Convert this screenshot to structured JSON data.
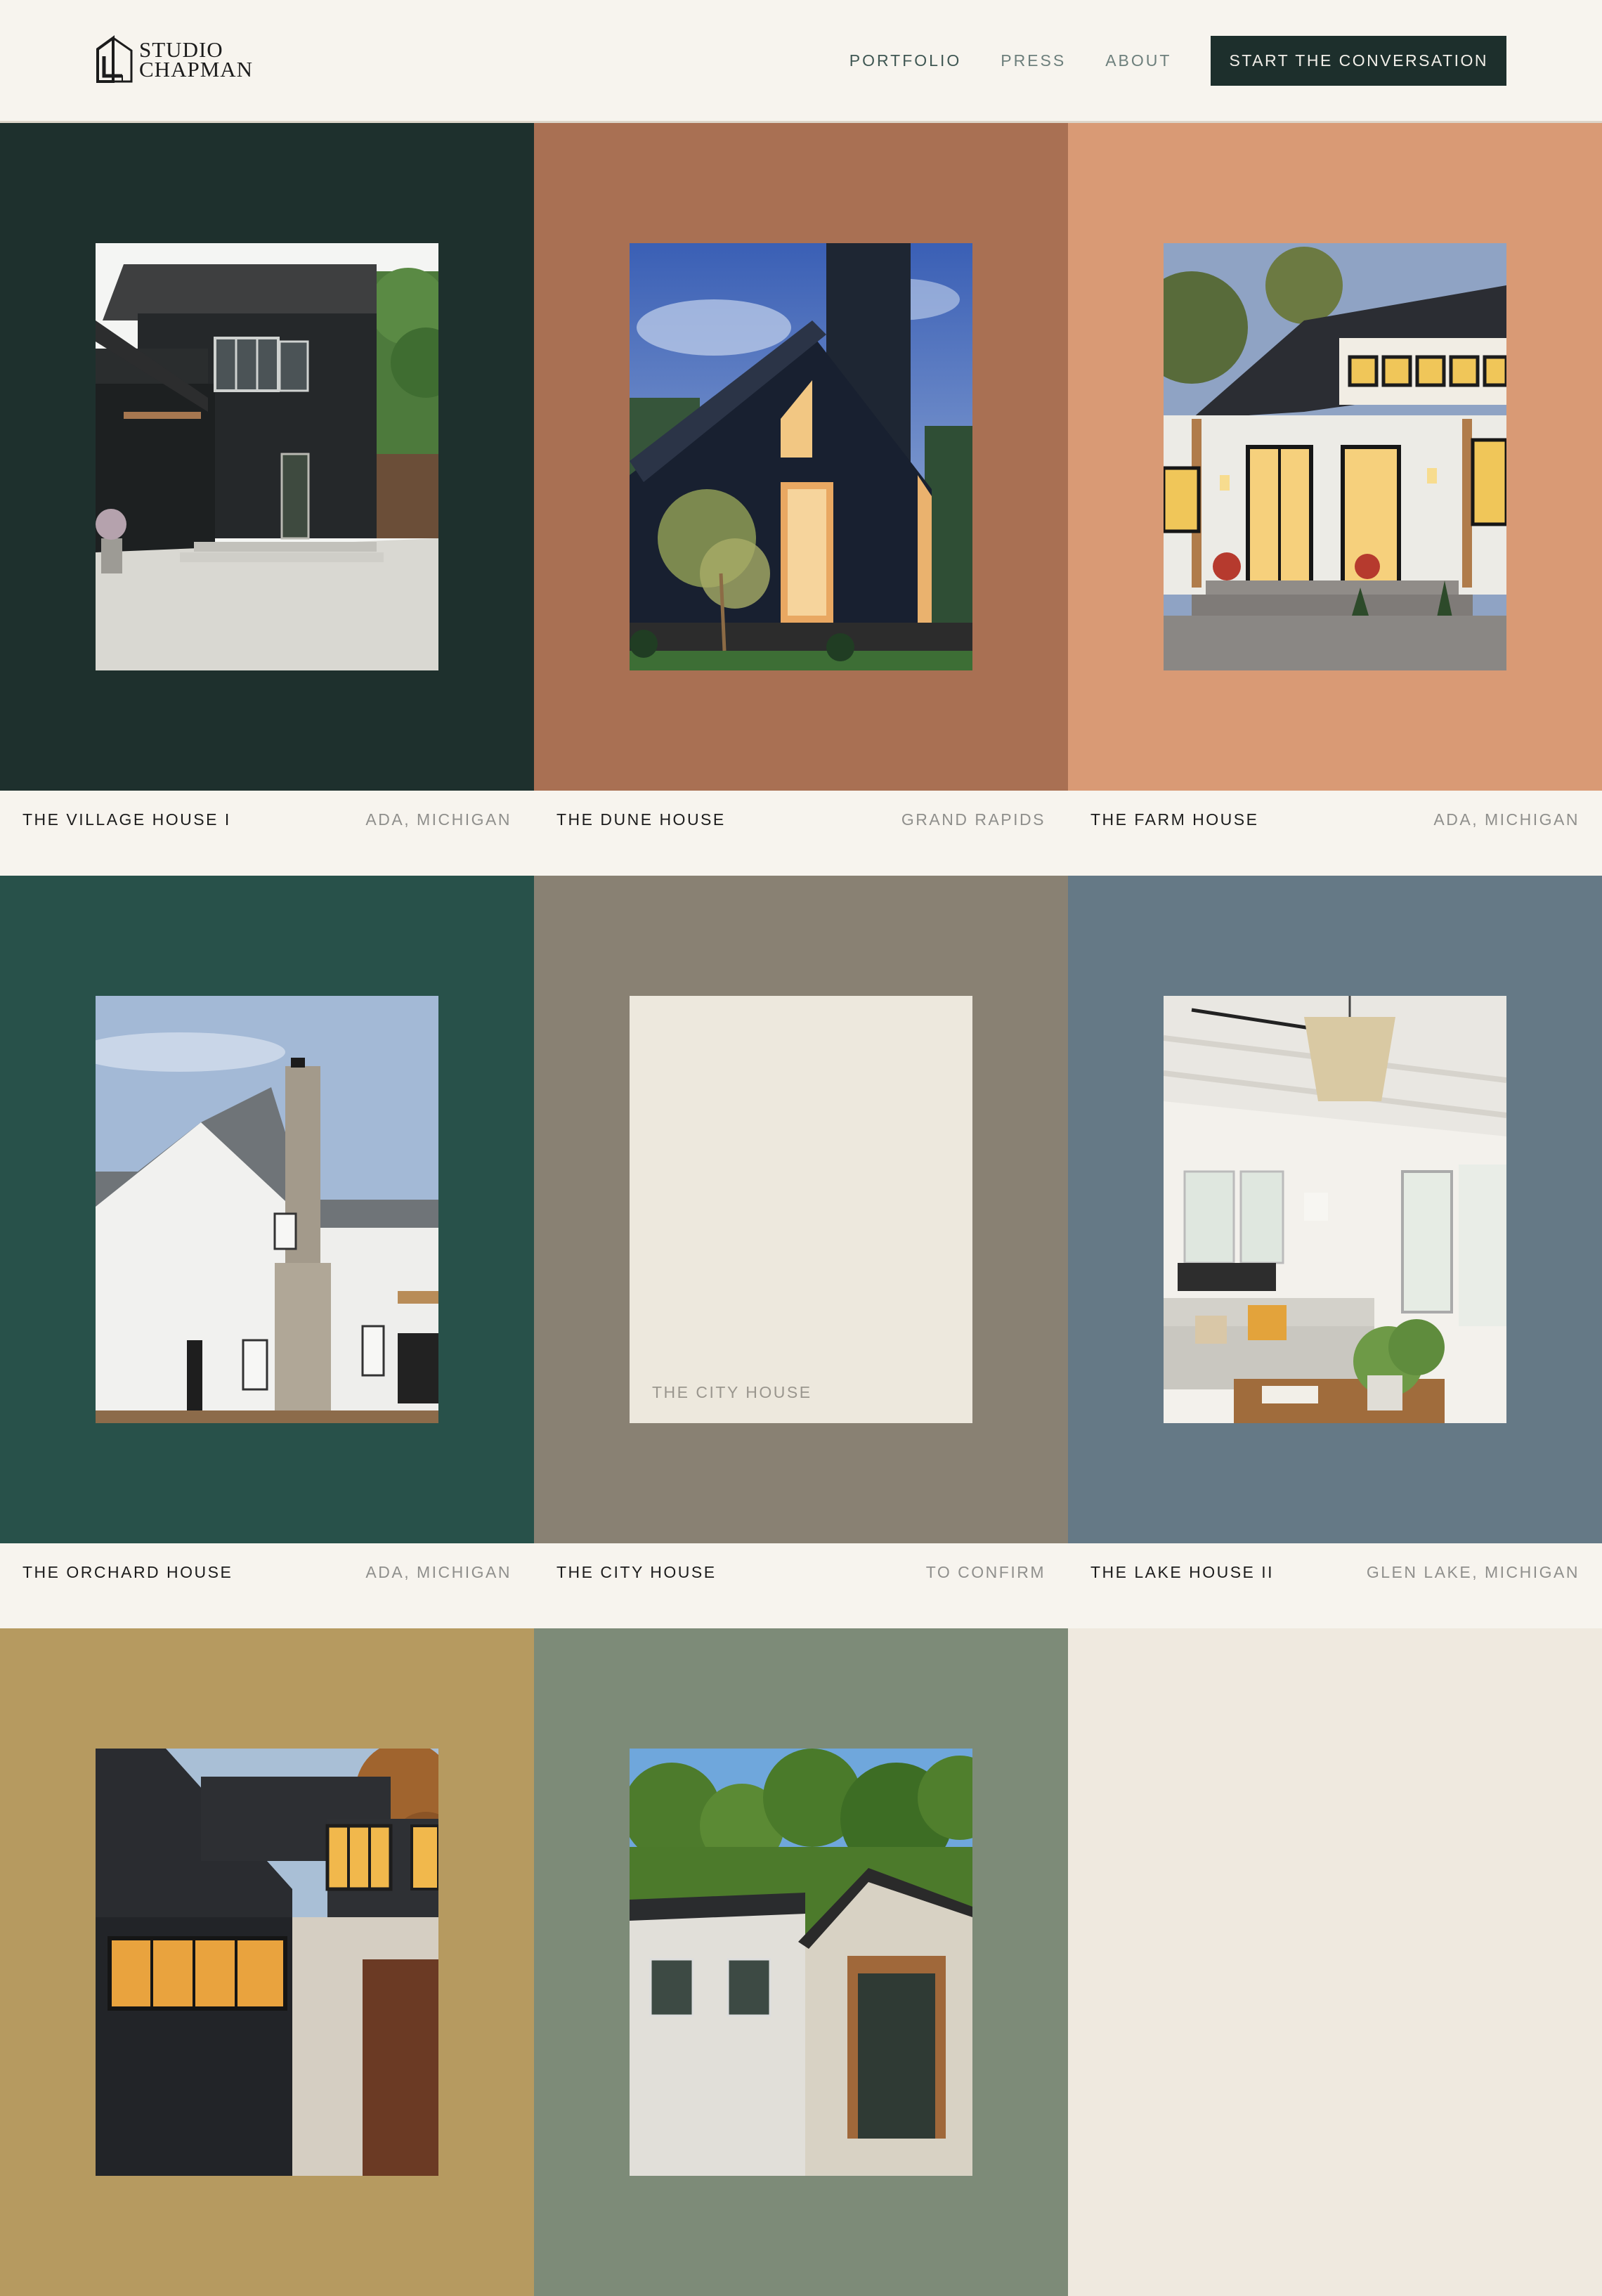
{
  "brand": {
    "line1": "STUDIO",
    "line2": "CHAPMAN"
  },
  "nav": {
    "portfolio": "PORTFOLIO",
    "press": "PRESS",
    "about": "ABOUT",
    "cta": "START THE CONVERSATION"
  },
  "colors": {
    "dark_green": "#1e302d",
    "terracotta": "#a97053",
    "peach": "#d99a75",
    "forest": "#28514a",
    "taupe": "#898173",
    "slate": "#657986",
    "mustard": "#b69a60",
    "sage": "#7d8b78",
    "cream": "#efe9df"
  },
  "projects": [
    {
      "title": "THE VILLAGE HOUSE I",
      "location": "ADA, MICHIGAN",
      "color": "#1e302d",
      "image": "dark-siding-house-photo"
    },
    {
      "title": "THE DUNE HOUSE",
      "location": "GRAND RAPIDS",
      "color": "#a97053",
      "image": "a-frame-dusk-photo"
    },
    {
      "title": "THE FARM HOUSE",
      "location": "ADA, MICHIGAN",
      "color": "#d99a75",
      "image": "white-farmhouse-evening-photo"
    },
    {
      "title": "THE ORCHARD HOUSE",
      "location": "ADA, MICHIGAN",
      "color": "#28514a",
      "image": "white-house-stone-chimney-photo"
    },
    {
      "title": "THE CITY HOUSE",
      "location": "TO CONFIRM",
      "color": "#898173",
      "image": "placeholder",
      "placeholder_label": "THE CITY HOUSE"
    },
    {
      "title": "THE LAKE HOUSE II",
      "location": "GLEN LAKE, MICHIGAN",
      "color": "#657986",
      "image": "living-room-interior-photo"
    },
    {
      "title": "",
      "location": "",
      "color": "#b69a60",
      "image": "brick-house-dusk-photo"
    },
    {
      "title": "",
      "location": "",
      "color": "#7d8b78",
      "image": "modern-house-trees-photo"
    },
    {
      "title": "",
      "location": "",
      "color": "#efe9df",
      "image": ""
    }
  ]
}
